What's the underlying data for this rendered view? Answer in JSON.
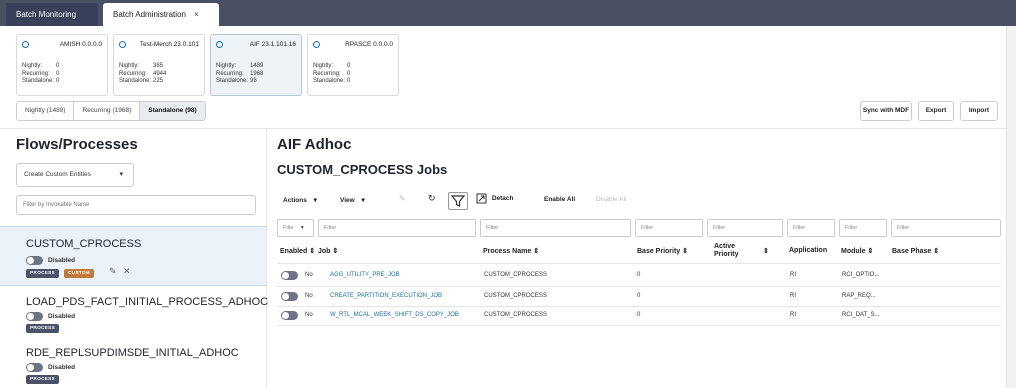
{
  "tabs": [
    {
      "label": "Batch Monitoring"
    },
    {
      "label": "Batch Administration",
      "close": "×"
    }
  ],
  "instances": [
    {
      "name": "AMISH 0.0.0.0",
      "nightly": "0",
      "recurring": "0",
      "standalone": "0"
    },
    {
      "name": "Test-Merch 23.0.101",
      "nightly": "385",
      "recurring": "4944",
      "standalone": "225"
    },
    {
      "name": "AIF 23.1.101.16",
      "nightly": "1489",
      "recurring": "1968",
      "standalone": "98"
    },
    {
      "name": "RPASCE 0.0.0.0",
      "nightly": "0",
      "recurring": "0",
      "standalone": "0"
    }
  ],
  "instance_labels": {
    "nightly": "Nightly:",
    "recurring": "Recurring:",
    "standalone": "Standalone:"
  },
  "schedule_tabs": [
    "Nightly (1489)",
    "Recurring (1968)",
    "Standalone (98)"
  ],
  "actions": {
    "sync": "Sync with MDF",
    "export": "Export",
    "import": "Import"
  },
  "left_panel": {
    "title": "Flows/Processes",
    "entity_select": "Create Custom Entities",
    "filter_placeholder": "Filter by Invokable Name",
    "flows": [
      {
        "name": "CUSTOM_CPROCESS",
        "status": "Disabled",
        "badges": [
          "PROCESS",
          "CUSTOM"
        ]
      },
      {
        "name": "LOAD_PDS_FACT_INITIAL_PROCESS_ADHOC",
        "status": "Disabled",
        "badges": [
          "PROCESS"
        ]
      },
      {
        "name": "RDE_REPLSUPDIMSDE_INITIAL_ADHOC",
        "status": "Disabled",
        "badges": [
          "PROCESS"
        ]
      }
    ]
  },
  "right_panel": {
    "title": "AIF Adhoc",
    "subtitle": "CUSTOM_CPROCESS Jobs",
    "toolbar": {
      "actions": "Actions",
      "view": "View",
      "detach": "Detach",
      "enable_all": "Enable All",
      "disable_all": "Disable All"
    },
    "filters": {
      "first": "Filte",
      "generic": "Filter"
    },
    "columns": [
      "Enabled",
      "Job",
      "Process Name",
      "Base Priority",
      "Active Priority",
      "Application",
      "Module",
      "Base Phase"
    ],
    "rows": [
      {
        "enabled": "No",
        "job": "AGG_UTILITY_PRE_JOB",
        "process": "CUSTOM_CPROCESS",
        "base_priority": "0",
        "application": "RI",
        "module": "RCI_OPTIO..."
      },
      {
        "enabled": "No",
        "job": "CREATE_PARTITION_EXECUTION_JOB",
        "process": "CUSTOM_CPROCESS",
        "base_priority": "0",
        "application": "RI",
        "module": "RAP_REQ..."
      },
      {
        "enabled": "No",
        "job": "W_RTL_MCAL_WEEK_SHIFT_DS_COPY_JOB",
        "process": "CUSTOM_CPROCESS",
        "base_priority": "0",
        "application": "RI",
        "module": "RCI_DAT_S..."
      }
    ]
  },
  "icons": {
    "sort": "⇕",
    "caret": "▾",
    "refresh": "↻",
    "edit": "✎",
    "close": "✕"
  },
  "colors": {
    "topbar": "#4a5063",
    "accent": "#1d6fa8",
    "custom_badge": "#c17a3d",
    "process_badge": "#4a5268"
  }
}
